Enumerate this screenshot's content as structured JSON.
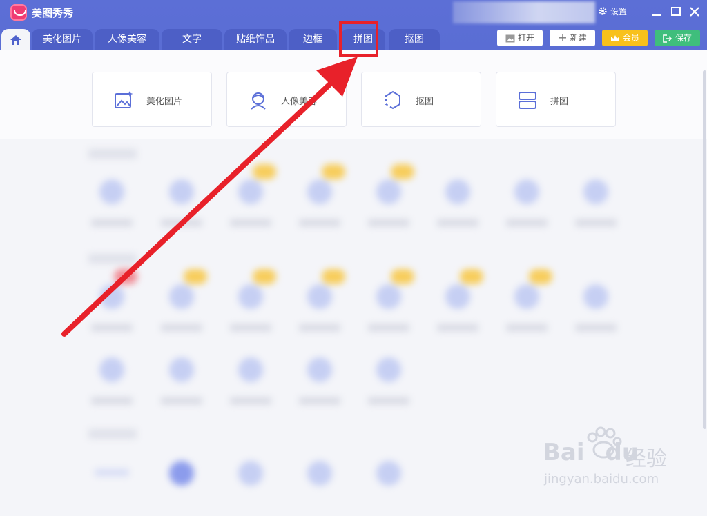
{
  "app": {
    "title": "美图秀秀"
  },
  "titlebar": {
    "settings_label": "设置"
  },
  "tabs": [
    "美化图片",
    "人像美容",
    "文字",
    "贴纸饰品",
    "边框",
    "拼图",
    "抠图"
  ],
  "toolbar": {
    "open_label": "打开",
    "new_label": "新建",
    "vip_label": "会员",
    "save_label": "保存"
  },
  "quick_cards": [
    "美化图片",
    "人像美容",
    "抠图",
    "拼图"
  ],
  "watermark": {
    "brand": "Bai",
    "brand2": "du",
    "cn": "经验",
    "url": "jingyan.baidu.com"
  },
  "colors": {
    "titlebar": "#5a6dd4",
    "accent_red": "#e8212a",
    "vip": "#f8c11c",
    "save": "#3fbe7c"
  }
}
